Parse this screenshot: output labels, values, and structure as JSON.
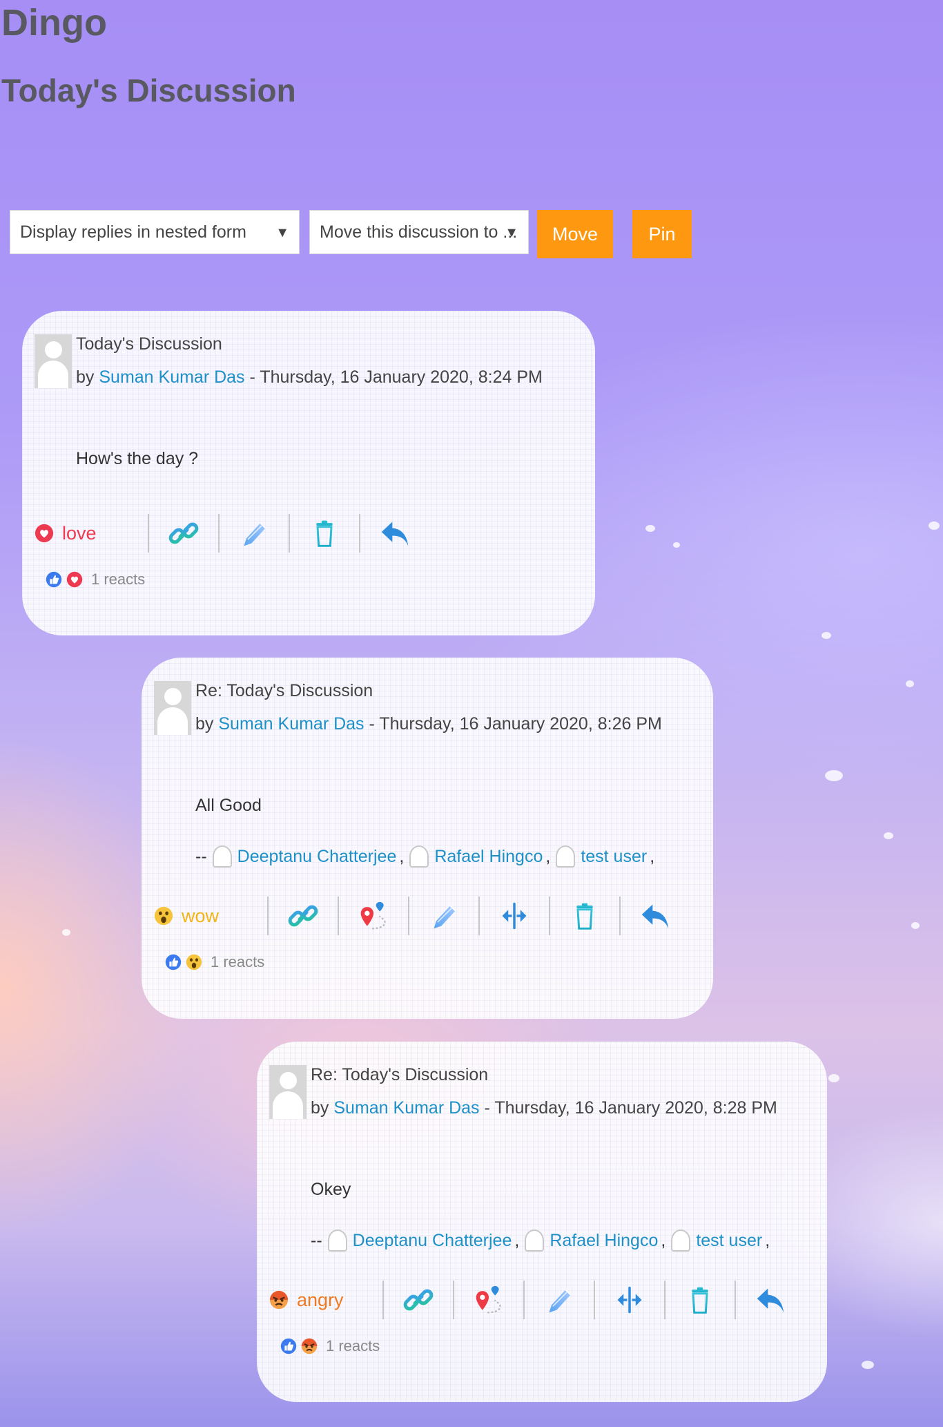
{
  "site": {
    "title": "Dingo"
  },
  "page": {
    "heading": "Today's Discussion"
  },
  "toolbar": {
    "display_select": "Display replies in nested form",
    "move_select": "Move this discussion to ...",
    "move_button": "Move",
    "pin_button": "Pin"
  },
  "posts": [
    {
      "subject": "Today's Discussion",
      "by": "by",
      "author": "Suman Kumar Das",
      "date": "- Thursday, 16 January 2020, 8:24 PM",
      "message": "How's the day ?",
      "reaction": "love",
      "reacts": "1 reacts",
      "colors": {
        "reaction": "#ee3a50"
      }
    },
    {
      "subject": "Re: Today's Discussion",
      "by": "by",
      "author": "Suman Kumar Das",
      "date": "- Thursday, 16 January 2020, 8:26 PM",
      "message": "All Good",
      "mentions_prefix": "--",
      "mentions": [
        "Deeptanu Chatterjee",
        "Rafael Hingco",
        "test user"
      ],
      "reaction": "wow",
      "reacts": "1 reacts",
      "colors": {
        "reaction": "#f2b418"
      }
    },
    {
      "subject": "Re: Today's Discussion",
      "by": "by",
      "author": "Suman Kumar Das",
      "date": "- Thursday, 16 January 2020, 8:28 PM",
      "message": "Okey",
      "mentions_prefix": "--",
      "mentions": [
        "Deeptanu Chatterjee",
        "Rafael Hingco",
        "test user"
      ],
      "reaction": "angry",
      "reacts": "1 reacts",
      "colors": {
        "reaction": "#f07a22"
      }
    }
  ],
  "icons": [
    "heart-icon",
    "wow-face-icon",
    "angry-face-icon",
    "link-icon",
    "edit-pencil-icon",
    "delete-trash-icon",
    "reply-arrow-icon",
    "map-pin-icon",
    "split-icon",
    "thumbs-up-icon"
  ]
}
